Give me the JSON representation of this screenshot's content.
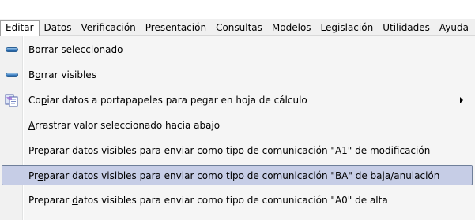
{
  "menubar": {
    "items": [
      {
        "pre": "",
        "key": "E",
        "post": "ditar"
      },
      {
        "pre": "",
        "key": "D",
        "post": "atos"
      },
      {
        "pre": "",
        "key": "V",
        "post": "erificación"
      },
      {
        "pre": "Pr",
        "key": "e",
        "post": "sentación"
      },
      {
        "pre": "",
        "key": "C",
        "post": "onsultas"
      },
      {
        "pre": "",
        "key": "M",
        "post": "odelos"
      },
      {
        "pre": "",
        "key": "L",
        "post": "egislación"
      },
      {
        "pre": "",
        "key": "U",
        "post": "tilidades"
      },
      {
        "pre": "Ay",
        "key": "u",
        "post": "da"
      }
    ]
  },
  "menu": {
    "items": [
      {
        "pre": "",
        "key": "B",
        "post": "orrar seleccionado",
        "icon": "remove-pill-icon"
      },
      {
        "pre": "B",
        "key": "o",
        "post": "rrar visibles",
        "icon": "remove-pill-icon"
      },
      {
        "pre": "Co",
        "key": "p",
        "post": "iar datos a portapapeles para pegar en hoja de cálculo",
        "icon": "copy-clipboard-icon"
      },
      {
        "pre": "",
        "key": "A",
        "post": "rrastrar valor seleccionado hacia abajo",
        "icon": ""
      },
      {
        "pre": "P",
        "key": "r",
        "post": "eparar datos visibles para enviar como tipo de comunicación \"A1\" de modificación",
        "icon": ""
      },
      {
        "pre": "Pr",
        "key": "e",
        "post": "parar datos visibles para enviar como tipo de comunicación \"BA\" de baja/anulación",
        "icon": ""
      },
      {
        "pre": "Preparar ",
        "key": "d",
        "post": "atos visibles para enviar como tipo de comunicación \"A0\" de alta",
        "icon": ""
      }
    ]
  },
  "colors": {
    "highlight": "#c6cde6",
    "highlight_border": "#6f7f9a"
  }
}
